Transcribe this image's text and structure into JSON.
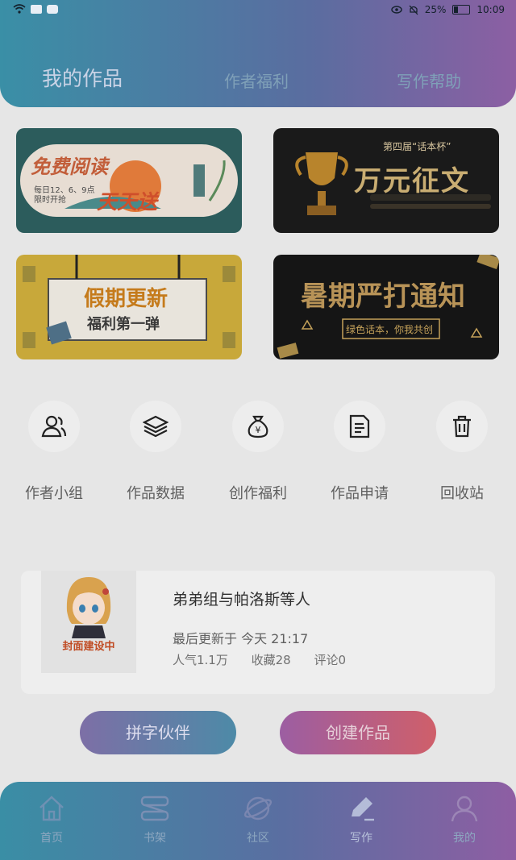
{
  "status_bar": {
    "battery": "25%",
    "time": "10:09"
  },
  "header_tabs": [
    "我的作品",
    "作者福利",
    "写作帮助"
  ],
  "banners": {
    "b1": {
      "title": "免费阅读",
      "subtitle": "天天送",
      "note_line1": "每日12、6、9点",
      "note_line2": "限时开抢"
    },
    "b2": {
      "kicker": "第四届“话本杯”",
      "title": "万元征文"
    },
    "b3": {
      "title": "假期更新",
      "subtitle": "福利第一弹"
    },
    "b4": {
      "title": "暑期严打通知",
      "subtitle": "绿色话本，你我共创"
    }
  },
  "quick_actions": [
    {
      "label": "作者小组",
      "icon": "group-icon"
    },
    {
      "label": "作品数据",
      "icon": "layers-icon"
    },
    {
      "label": "创作福利",
      "icon": "money-bag-icon"
    },
    {
      "label": "作品申请",
      "icon": "document-icon"
    },
    {
      "label": "回收站",
      "icon": "trash-icon"
    }
  ],
  "work": {
    "cover_label": "封面建设中",
    "title": "弟弟组与帕洛斯等人",
    "last_update": "最后更新于 今天 21:17",
    "popularity": "人气1.1万",
    "favorites": "收藏28",
    "comments": "评论0"
  },
  "buttons": {
    "partner": "拼字伙伴",
    "create": "创建作品"
  },
  "bottom_nav": [
    "首页",
    "书架",
    "社区",
    "写作",
    "我的"
  ],
  "colors": {
    "header_start": "#3a8fa6",
    "header_end": "#8c5fa3",
    "create_btn": "#cf5f6a"
  }
}
